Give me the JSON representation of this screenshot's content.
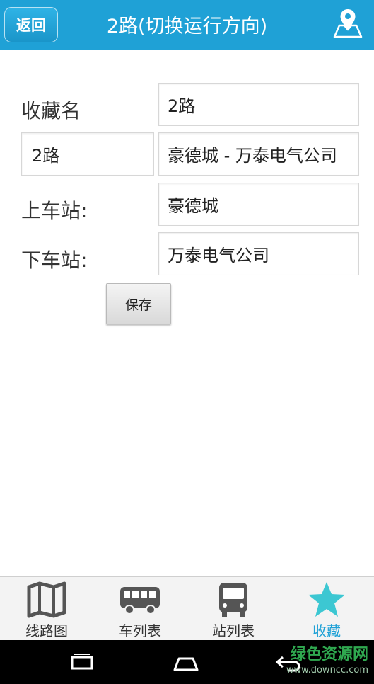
{
  "header": {
    "back_label": "返回",
    "title": "2路(切换运行方向)"
  },
  "form": {
    "favorite_name_label": "收藏名",
    "favorite_name_value": "2路",
    "route_value": "2路",
    "direction_value": "豪德城 - 万泰电气公司",
    "board_stop_label": "上车站:",
    "board_stop_value": "豪德城",
    "alight_stop_label": "下车站:",
    "alight_stop_value": "万泰电气公司",
    "save_label": "保存"
  },
  "tabs": [
    {
      "label": "线路图",
      "icon": "map-icon",
      "active": false
    },
    {
      "label": "车列表",
      "icon": "bus-side-icon",
      "active": false
    },
    {
      "label": "站列表",
      "icon": "bus-front-icon",
      "active": false
    },
    {
      "label": "收藏",
      "icon": "star-icon",
      "active": true
    }
  ],
  "watermark": {
    "main": "绿色资源网",
    "sub": "www.downcc.com"
  },
  "colors": {
    "accent": "#1fa1d6",
    "active_tab": "#1fa1d6",
    "star": "#3cc7d2"
  }
}
